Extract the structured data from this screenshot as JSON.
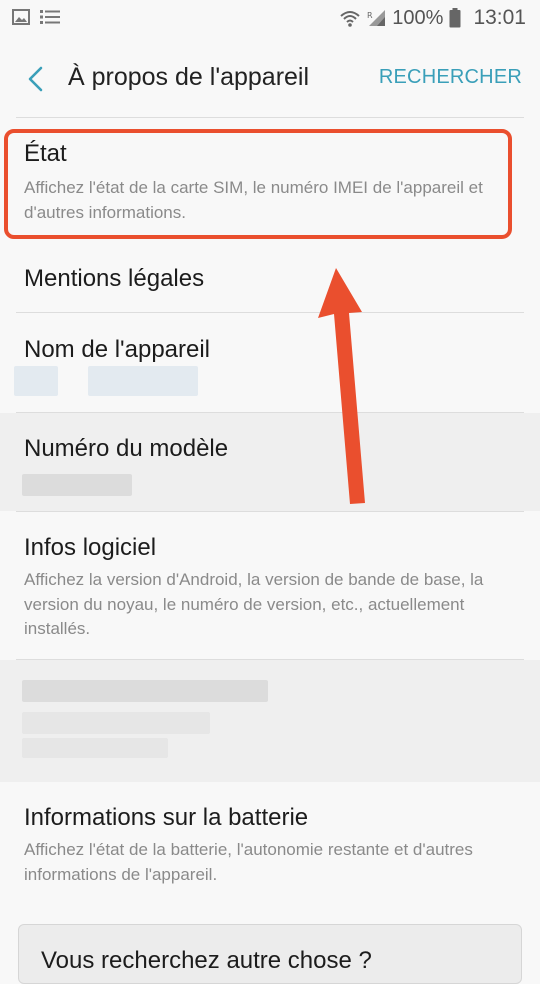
{
  "statusbar": {
    "battery_percent": "100%",
    "time": "13:01",
    "icons": [
      "image-icon",
      "list-icon",
      "wifi-icon",
      "signal-icon",
      "battery-icon"
    ]
  },
  "appbar": {
    "title": "À propos de l'appareil",
    "search_label": "RECHERCHER",
    "accent": "#3a9fb9"
  },
  "items": [
    {
      "title": "État",
      "subtitle": "Affichez l'état de la carte SIM, le numéro IMEI de l'appareil et d'autres informations."
    },
    {
      "title": "Mentions légales"
    },
    {
      "title": "Nom de l'appareil"
    },
    {
      "title": "Numéro du modèle"
    },
    {
      "title": "Infos logiciel",
      "subtitle": "Affichez la version d'Android, la version de bande de base, la version du noyau, le numéro de version, etc., actuellement installés."
    },
    {
      "title": "Informations sur la batterie",
      "subtitle": "Affichez l'état de la batterie, l'autonomie restante et d'autres informations de l'appareil."
    }
  ],
  "bottom_card": {
    "text": "Vous recherchez autre chose ?"
  },
  "annotation": {
    "highlight_color": "#ea4f2e"
  }
}
